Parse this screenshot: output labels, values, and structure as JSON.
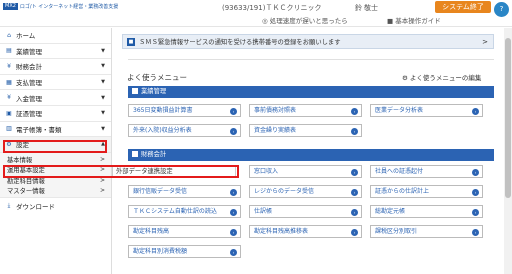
{
  "header": {
    "logo_badge": "MX2",
    "logo_text": "ロゴ/ト インターネット経営・業務改善支援",
    "clinic_info": "(93633/191)ＴＫＣクリニック",
    "user_name": "鈴",
    "user_name_2": "敬士",
    "system_end": "システム終了",
    "help_link": "◎ 処理速度が遅いと思ったら",
    "manual_link": "■ 基本操作ガイド",
    "help_badge": "?"
  },
  "sidebar": {
    "items": [
      {
        "icon": "home-icon",
        "glyph": "⌂",
        "label": "ホーム"
      },
      {
        "icon": "chart-icon",
        "glyph": "▤",
        "label": "業績管理",
        "arrow": "▼"
      },
      {
        "icon": "yen-icon",
        "glyph": "¥",
        "label": "財務会計",
        "arrow": "▼"
      },
      {
        "icon": "doc-icon",
        "glyph": "▦",
        "label": "支払管理",
        "arrow": "▼"
      },
      {
        "icon": "coin-icon",
        "glyph": "¥",
        "label": "入金管理",
        "arrow": "▼"
      },
      {
        "icon": "file-icon",
        "glyph": "▣",
        "label": "証憑管理",
        "arrow": "▼"
      },
      {
        "icon": "book-icon",
        "glyph": "▥",
        "label": "電子帳簿・書類",
        "arrow": "▼"
      },
      {
        "icon": "gear-icon",
        "glyph": "⚙",
        "label": "設定",
        "arrow": "▲"
      }
    ],
    "sub_items": [
      {
        "label": "基本情報",
        "arrow": ">"
      },
      {
        "label": "運用基本設定",
        "arrow": ">"
      },
      {
        "label": "勘定科目情報",
        "arrow": ">"
      },
      {
        "label": "マスター情報",
        "arrow": ">"
      }
    ],
    "download": {
      "glyph": "⤓",
      "label": "ダウンロード"
    }
  },
  "flyout": {
    "label": "外部データ連携設定"
  },
  "main": {
    "notice": "ＳＭＳ緊急情報サービスの通知を受ける携帯番号の登録をお願いします",
    "notice_arrow": ">",
    "menu_title": "よく使うメニュー",
    "edit_link": "⚙ よく使うメニューの編集",
    "sections": [
      {
        "title": "業績管理",
        "buttons": [
          "365日変動損益計算書",
          "事前債務対照表",
          "医業データ分析表",
          "外来(入院)収益分析表",
          "資金繰り実績表"
        ]
      },
      {
        "title": "財務会計",
        "buttons": [
          "窓口収入",
          "社員への証憑起付",
          "銀行信販データ受信",
          "レジからのデータ受信",
          "証憑からの仕訳計上",
          "ＴＫＣシステム自動仕訳の読込",
          "仕訳帳",
          "総勘定元帳",
          "勘定科目残高",
          "勘定科目残高推移表",
          "課税区分別取引",
          "勘定科目別消費税額"
        ]
      }
    ]
  }
}
